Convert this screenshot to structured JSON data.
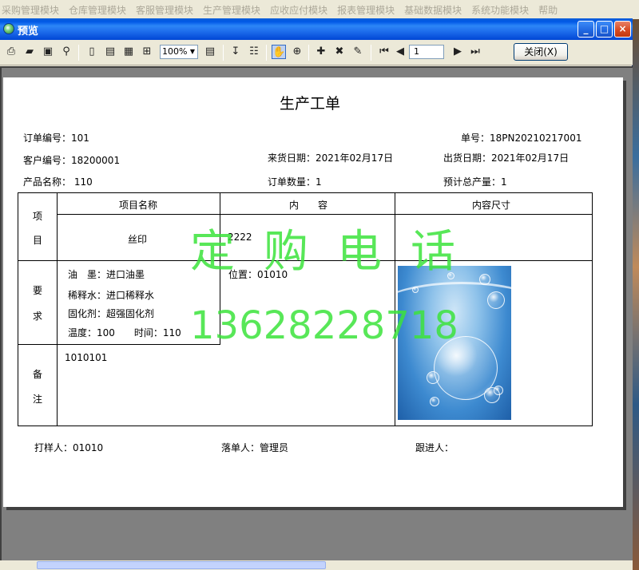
{
  "app_menu": [
    "采购管理模块",
    "仓库管理模块",
    "客服管理模块",
    "生产管理模块",
    "应收应付模块",
    "报表管理模块",
    "基础数据模块",
    "系统功能模块",
    "帮助"
  ],
  "window": {
    "title": "预览",
    "min": "_",
    "max": "□",
    "close": "×"
  },
  "toolbar": {
    "zoom": "100%",
    "page": "1",
    "close_label": "关闭(X)"
  },
  "report": {
    "title": "生产工单",
    "order_no_label": "订单编号：101",
    "doc_no_label": "单号：18PN20210217001",
    "customer_label": "客户编号：18200001",
    "arrival_label": "来货日期：2021年02月17日",
    "ship_label": "出货日期：2021年02月17日",
    "product_label": "产品名称：  110",
    "qty_label": "订单数量：1",
    "total_label": "预计总产量：1",
    "table": {
      "col_item": "项目名称",
      "col_content": "内　　容",
      "col_size": "内容尺寸",
      "row1_label": [
        "项",
        "目"
      ],
      "item_name": "丝印",
      "content_value": "2222",
      "row2_label": [
        "要",
        "求"
      ],
      "ink": "油　墨：进口油墨",
      "thinner": "稀释水：进口稀释水",
      "curing": "固化剂：超强固化剂",
      "temp_time": "温度：100　　时间：110",
      "position": "位置：01010",
      "row3_label": [
        "备",
        "注"
      ],
      "remark": "1010101"
    },
    "sampler": "打样人：01010",
    "order_person": "落单人：管理员",
    "follower": "跟进人："
  },
  "watermark": {
    "line1": "定购电话",
    "line2": "13628228718"
  }
}
